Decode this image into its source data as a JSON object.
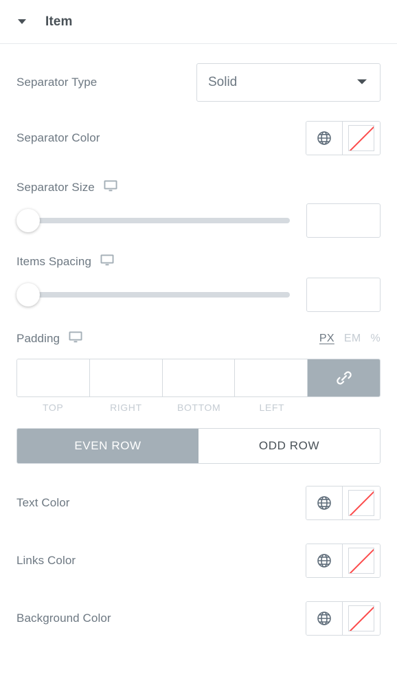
{
  "section": {
    "title": "Item",
    "collapse_icon": "caret-down-icon",
    "expanded": true
  },
  "controls": {
    "separator_type": {
      "label": "Separator Type",
      "value": "Solid",
      "caret_icon": "chevron-down-icon"
    },
    "separator_color": {
      "label": "Separator Color",
      "globe_icon": "globe-icon",
      "swatch": "no-color-swatch"
    },
    "separator_size": {
      "label": "Separator Size",
      "device_icon": "desktop-icon",
      "slider_value": 0,
      "slider_min": 0,
      "slider_max": 100,
      "input_value": "",
      "input_placeholder": ""
    },
    "items_spacing": {
      "label": "Items Spacing",
      "device_icon": "desktop-icon",
      "slider_value": 0,
      "slider_min": 0,
      "slider_max": 100,
      "input_value": "",
      "input_placeholder": ""
    },
    "padding": {
      "label": "Padding",
      "device_icon": "desktop-icon",
      "units": [
        {
          "label": "PX",
          "active": true
        },
        {
          "label": "EM",
          "active": false
        },
        {
          "label": "%",
          "active": false
        }
      ],
      "fields": [
        {
          "side": "TOP",
          "value": ""
        },
        {
          "side": "RIGHT",
          "value": ""
        },
        {
          "side": "BOTTOM",
          "value": ""
        },
        {
          "side": "LEFT",
          "value": ""
        }
      ],
      "link_icon": "link-icon",
      "link_active": true
    },
    "row_tabs": [
      {
        "label": "EVEN ROW",
        "active": true
      },
      {
        "label": "ODD ROW",
        "active": false
      }
    ],
    "text_color": {
      "label": "Text Color",
      "globe_icon": "globe-icon",
      "swatch": "no-color-swatch"
    },
    "links_color": {
      "label": "Links Color",
      "globe_icon": "globe-icon",
      "swatch": "no-color-swatch"
    },
    "background_color": {
      "label": "Background Color",
      "globe_icon": "globe-icon",
      "swatch": "no-color-swatch"
    }
  },
  "colors": {
    "panel_bg": "#ffffff",
    "label_text": "#6d7882",
    "title_text": "#495157",
    "border": "#d5dadf",
    "divider": "#e6e9ec",
    "muted_text": "#c5ccd3",
    "active_bg": "#a4afb7",
    "swatch_slash": "#fc4b4b",
    "icon_gray": "#a4afb7",
    "globe": "#5f6d7a"
  }
}
